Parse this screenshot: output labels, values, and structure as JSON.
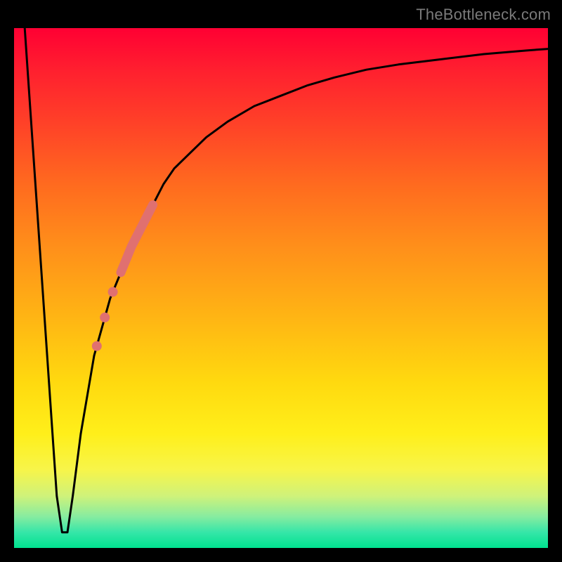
{
  "watermark": "TheBottleneck.com",
  "colors": {
    "background": "#000000",
    "curve": "#000000",
    "marker": "#e07070",
    "gradient_top": "#ff0033",
    "gradient_bottom": "#00e28f"
  },
  "chart_data": {
    "type": "line",
    "title": "",
    "xlabel": "",
    "ylabel": "",
    "xlim": [
      0,
      100
    ],
    "ylim": [
      0,
      100
    ],
    "grid": false,
    "legend": false,
    "series": [
      {
        "name": "bottleneck-curve",
        "x": [
          2,
          6,
          8,
          9,
          10,
          11,
          12.5,
          15,
          18,
          20,
          22,
          24,
          26,
          28,
          30,
          33,
          36,
          40,
          45,
          50,
          55,
          60,
          66,
          72,
          80,
          88,
          96,
          100
        ],
        "values": [
          100,
          40,
          10,
          3,
          3,
          10,
          22,
          37,
          48,
          53,
          58,
          62,
          66,
          70,
          73,
          76,
          79,
          82,
          85,
          87,
          89,
          90.5,
          92,
          93,
          94,
          95,
          95.7,
          96
        ]
      }
    ],
    "markers": [
      {
        "name": "highlight-band",
        "x_start": 20,
        "x_end": 26,
        "along_series": "bottleneck-curve",
        "style": "thick"
      },
      {
        "name": "point-a",
        "x": 18.5,
        "along_series": "bottleneck-curve",
        "style": "dot"
      },
      {
        "name": "point-b",
        "x": 17.0,
        "along_series": "bottleneck-curve",
        "style": "dot"
      },
      {
        "name": "point-c",
        "x": 15.5,
        "along_series": "bottleneck-curve",
        "style": "dot"
      }
    ]
  }
}
